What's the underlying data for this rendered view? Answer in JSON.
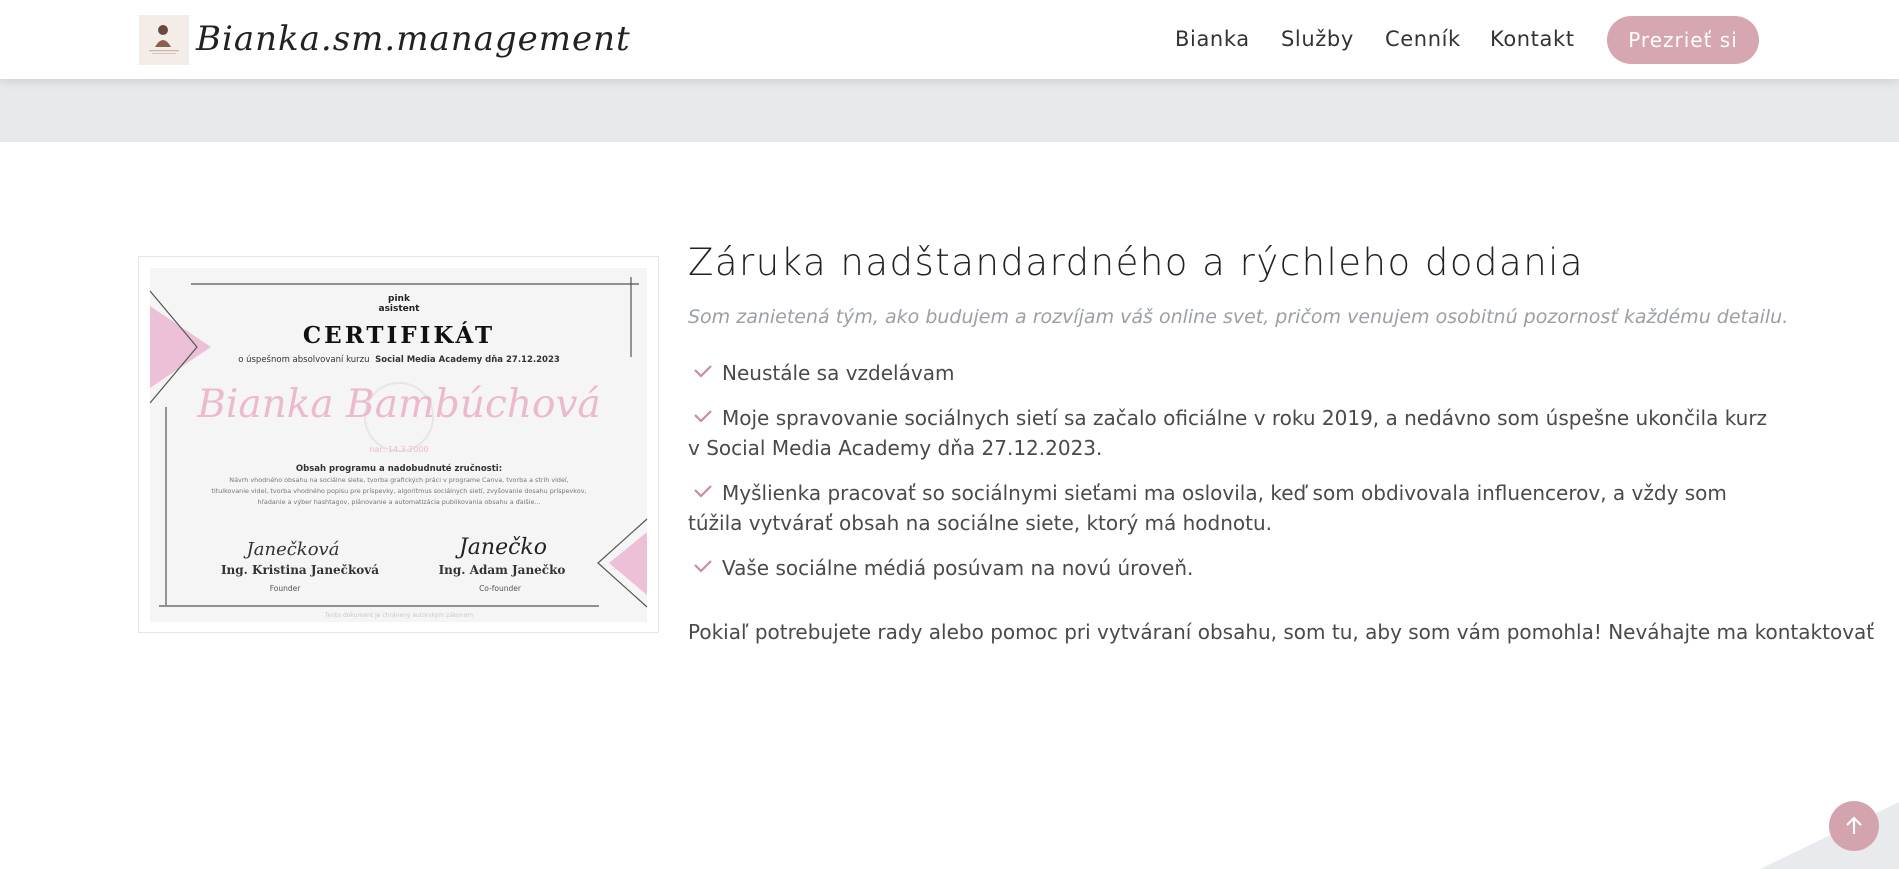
{
  "header": {
    "brand": "Bianka.sm.management",
    "nav": [
      {
        "label": "Bianka"
      },
      {
        "label": "Služby"
      },
      {
        "label": "Cenník"
      },
      {
        "label": "Kontakt"
      }
    ],
    "cta_label": "Prezrieť si"
  },
  "certificate": {
    "brand_top": "pink",
    "brand_bottom": "asistent",
    "heading": "CERTIFIKÁT",
    "course_line_prefix": "o úspešnom absolvovaní kurzu",
    "course_line_bold": "Social Media Academy dňa 27.12.2023",
    "name": "Bianka Bambúchová",
    "birth": "nar: 14.3.2000",
    "program_heading": "Obsah programu a nadobudnuté zručnosti:",
    "program_lines": [
      "Návrh vhodného obsahu na sociálne siete, tvorba grafických práci v programe Canva, tvorba a strih videí,",
      "titulkovanie videí, tvorba vhodného popisu pre príspevky, algoritmus sociálnych sietí, zvyšovanie dosahu príspevkov,",
      "hľadanie a výber hashtagov, plánovanie a automatizácia publikovania obsahu a ďalšie..."
    ],
    "signer1_signature": "Janečková",
    "signer1_name": "Ing. Kristina Janečková",
    "signer1_role": "Founder",
    "signer2_signature": "Janečko",
    "signer2_name": "Ing. Adam Janečko",
    "signer2_role": "Co-founder",
    "footer_note": "Tento dokument je chránený autorským zákonom"
  },
  "section": {
    "title": "Záruka nadštandardného a rýchleho dodania",
    "subtitle": "Som zanietená tým, ako budujem a rozvíjam váš online svet, pričom venujem osobitnú pozornosť každému detailu.",
    "facts": [
      {
        "text": "Neustále sa vzdelávam"
      },
      {
        "text": "Moje spravovanie sociálnych sietí sa začalo oficiálne v roku 2019, a nedávno som úspešne ukončila kurz v Social Media Academy dňa 27.12.2023."
      },
      {
        "text": "Myšlienka pracovať so sociálnymi sieťami ma oslovila, keď som obdivovala influencerov, a vždy som túžila vytvárať obsah na sociálne siete, ktorý má hodnotu."
      },
      {
        "text": "Vaše sociálne médiá posúvam na novú úroveň."
      }
    ],
    "closing": "Pokiaľ potrebujete rady alebo pomoc pri vytváraní obsahu, som tu, aby som vám pomohla! Neváhajte ma kontaktovať"
  },
  "colors": {
    "accent": "#d6a7b1",
    "check": "#c78f9c",
    "cert_pink": "#ecc1d8",
    "cert_bg": "#f5f5f5",
    "band": "#e7e9ed"
  },
  "icons": {
    "check": "check-icon",
    "back_to_top": "arrow-up-icon"
  }
}
